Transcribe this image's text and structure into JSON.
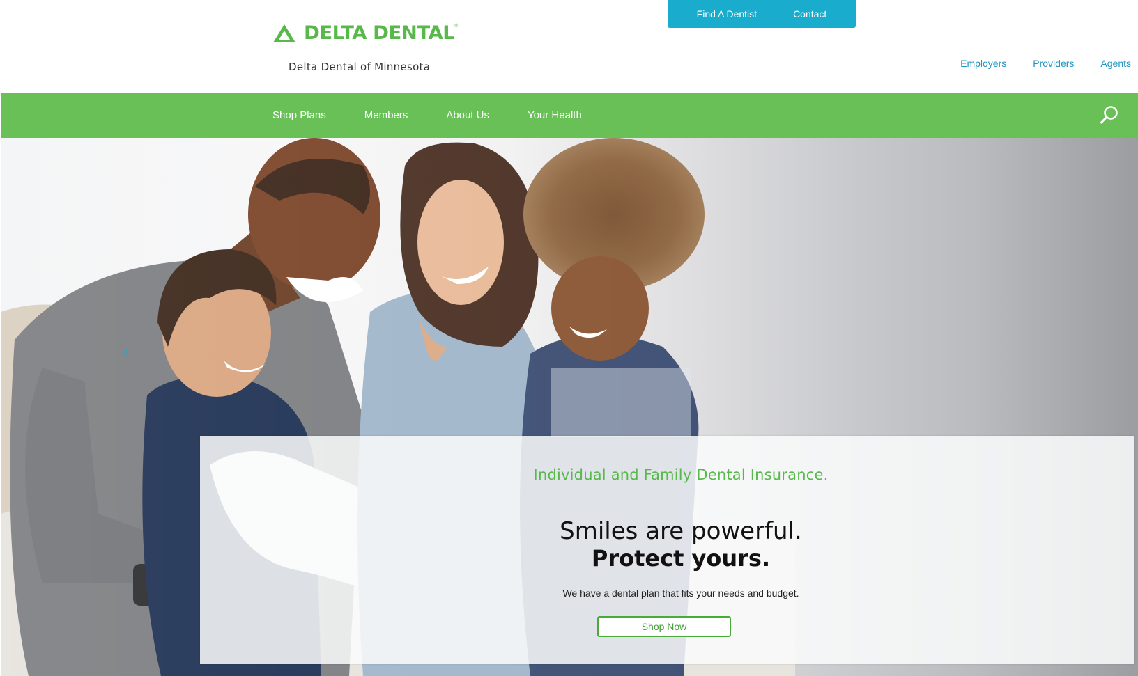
{
  "header": {
    "logo_word": "DELTA DENTAL",
    "logo_reg": "®",
    "org_name": "Delta Dental of Minnesota",
    "utility": {
      "find_dentist": "Find A Dentist",
      "contact": "Contact"
    },
    "audience": [
      "Employers",
      "Providers",
      "Agents"
    ]
  },
  "nav": {
    "items": [
      "Shop Plans",
      "Members",
      "About Us",
      "Your Health"
    ],
    "search_icon": "search-icon"
  },
  "hero": {
    "prev_arrow": "‹",
    "kicker": "Individual and Family Dental Insurance.",
    "headline_line1": "Smiles are powerful.",
    "headline_line2": "Protect yours.",
    "body": "We have a dental plan that fits your needs and budget.",
    "cta": "Shop Now"
  },
  "colors": {
    "brand_green": "#58b84a",
    "nav_green": "#68c057",
    "utility_blue": "#1aaccd",
    "link_blue": "#1f95c1"
  }
}
